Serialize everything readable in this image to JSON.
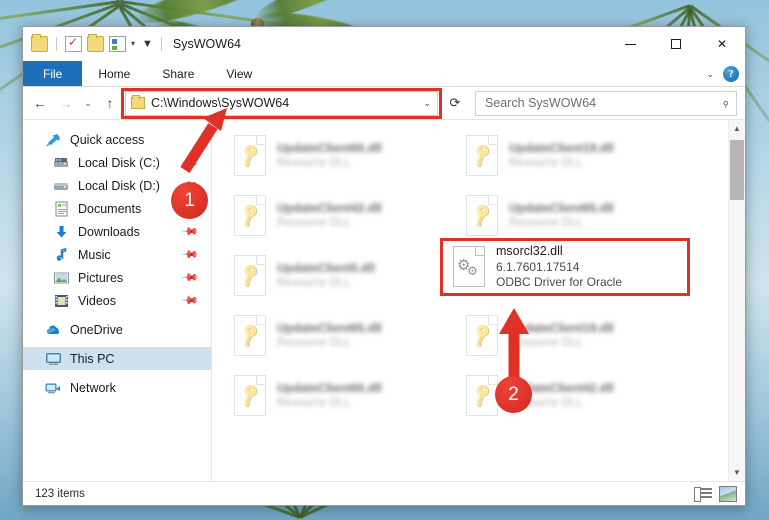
{
  "window": {
    "title": "SysWOW64",
    "quick_access_icons": [
      "folder-icon",
      "properties-check-icon",
      "new-folder-icon",
      "customize-icon",
      "dropdown-icon"
    ],
    "controls": {
      "minimize": "minimize-button",
      "maximize": "maximize-button",
      "close": "close-button"
    }
  },
  "ribbon": {
    "tabs": [
      {
        "label": "File",
        "active": true
      },
      {
        "label": "Home",
        "active": false
      },
      {
        "label": "Share",
        "active": false
      },
      {
        "label": "View",
        "active": false
      }
    ],
    "collapse_icon": "chevron-down-icon",
    "help_label": "?"
  },
  "addressbar": {
    "back_icon": "back-arrow-icon",
    "forward_icon": "forward-arrow-icon",
    "recent_icon": "chevron-down-icon",
    "up_icon": "up-arrow-icon",
    "path": "C:\\Windows\\SysWOW64",
    "dropdown_icon": "chevron-down-icon",
    "refresh_icon": "refresh-icon",
    "highlighted": true
  },
  "search": {
    "placeholder": "Search SysWOW64",
    "icon": "search-icon"
  },
  "sidebar": {
    "items": [
      {
        "label": "Quick access",
        "icon": "star-pin-icon",
        "pinned": false,
        "selected": false,
        "indent": 0
      },
      {
        "label": "Local Disk (C:)",
        "icon": "drive-icon",
        "pinned": true,
        "selected": false,
        "indent": 1
      },
      {
        "label": "Local Disk (D:)",
        "icon": "drive-icon",
        "pinned": true,
        "selected": false,
        "indent": 1
      },
      {
        "label": "Documents",
        "icon": "documents-icon",
        "pinned": true,
        "selected": false,
        "indent": 1
      },
      {
        "label": "Downloads",
        "icon": "downloads-icon",
        "pinned": true,
        "selected": false,
        "indent": 1
      },
      {
        "label": "Music",
        "icon": "music-icon",
        "pinned": true,
        "selected": false,
        "indent": 1
      },
      {
        "label": "Pictures",
        "icon": "pictures-icon",
        "pinned": true,
        "selected": false,
        "indent": 1
      },
      {
        "label": "Videos",
        "icon": "videos-icon",
        "pinned": true,
        "selected": false,
        "indent": 1
      },
      {
        "label": "OneDrive",
        "icon": "onedrive-cloud-icon",
        "pinned": false,
        "selected": false,
        "indent": 0
      },
      {
        "label": "This PC",
        "icon": "this-pc-monitor-icon",
        "pinned": false,
        "selected": true,
        "indent": 0
      },
      {
        "label": "Network",
        "icon": "network-icon",
        "pinned": false,
        "selected": false,
        "indent": 0
      }
    ]
  },
  "files": {
    "rows": [
      [
        {
          "name": "UpdateClient65.dll",
          "desc": "Resource DLL",
          "icon": "dll-key-icon",
          "blurred": true
        },
        {
          "name": "UpdateClient19.dll",
          "desc": "Resource DLL",
          "icon": "dll-key-icon",
          "blurred": true
        }
      ],
      [
        {
          "name": "UpdateClient42.dll",
          "desc": "Resource DLL",
          "icon": "dll-key-icon",
          "blurred": true
        },
        {
          "name": "UpdateClient65.dll",
          "desc": "Resource DLL",
          "icon": "dll-key-icon",
          "blurred": true
        }
      ],
      [
        {
          "name": "UpdateClient5.dll",
          "desc": "Resource DLL",
          "icon": "dll-key-icon",
          "blurred": true
        },
        {
          "name": "",
          "desc": "",
          "icon": "",
          "blurred": true
        }
      ],
      [
        {
          "name": "UpdateClient65.dll",
          "desc": "Resource DLL",
          "icon": "dll-key-icon",
          "blurred": true
        },
        {
          "name": "UpdateClient19.dll",
          "desc": "Resource DLL",
          "icon": "dll-key-icon",
          "blurred": true
        }
      ],
      [
        {
          "name": "UpdateClient65.dll",
          "desc": "Resource DLL",
          "icon": "dll-key-icon",
          "blurred": true
        },
        {
          "name": "UpdateClient42.dll",
          "desc": "Resource DLL",
          "icon": "dll-key-icon",
          "blurred": true
        }
      ]
    ],
    "selected_file": {
      "name": "msorcl32.dll",
      "version": "6.1.7601.17514",
      "description": "ODBC Driver for Oracle",
      "icon": "gears-dll-icon",
      "highlighted": true
    }
  },
  "statusbar": {
    "item_count": "123 items",
    "view_buttons": [
      "details-view-button",
      "large-icons-view-button"
    ]
  },
  "annotations": [
    {
      "number": "1",
      "target": "address-bar",
      "direction": "up-right",
      "color": "#d6302a"
    },
    {
      "number": "2",
      "target": "msorcl32-file",
      "direction": "up",
      "color": "#d6302a"
    }
  ],
  "colors": {
    "accent": "#1e6fba",
    "annotation_red": "#e03127",
    "selection_blue": "#cfe0ef"
  }
}
